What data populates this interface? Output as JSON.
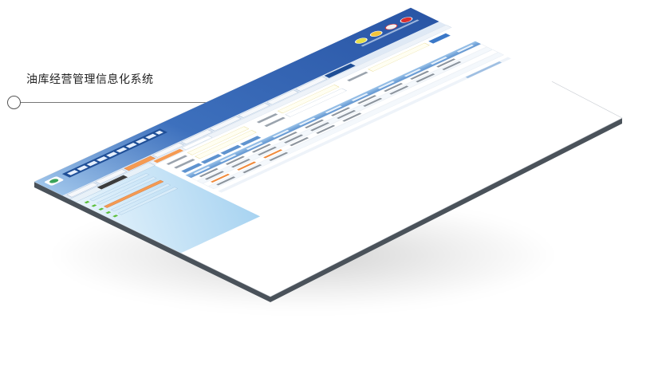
{
  "caption": "油库经营管理信息化系统",
  "colors": {
    "header_blue": "#2c5aa8",
    "header_light": "#6f9fd8",
    "sidebar_blue": "#bfe0f6",
    "table_header": "#7fb0de",
    "accent_orange": "#f08a3c",
    "border_gray": "#555e66"
  },
  "toolbar_icons": [
    "flower-icon",
    "sun-icon",
    "help-icon",
    "close-icon"
  ]
}
